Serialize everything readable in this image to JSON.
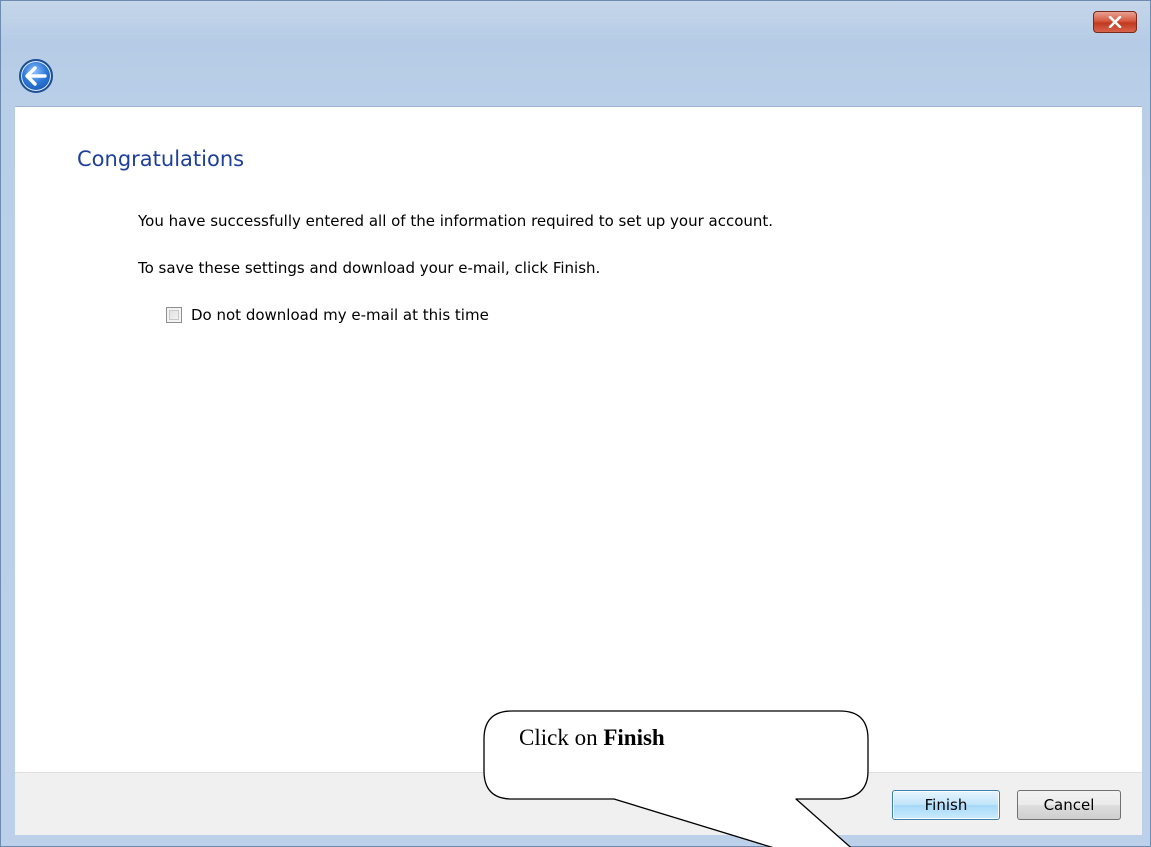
{
  "window": {
    "close_label": "Close",
    "back_label": "Back"
  },
  "page": {
    "title": "Congratulations",
    "line1": "You have successfully entered all of the information required to set up your account.",
    "line2": "To save these settings and download your e-mail, click Finish.",
    "checkbox_label": "Do not download my e-mail at this time",
    "checkbox_checked": false
  },
  "footer": {
    "finish_label": "Finish",
    "cancel_label": "Cancel"
  },
  "callout": {
    "prefix": "Click on ",
    "bold": "Finish"
  },
  "colors": {
    "title": "#1e3f9c",
    "chrome": "#b9cfe8",
    "close": "#c2391f"
  },
  "icons": [
    "close-icon",
    "back-arrow-icon"
  ]
}
